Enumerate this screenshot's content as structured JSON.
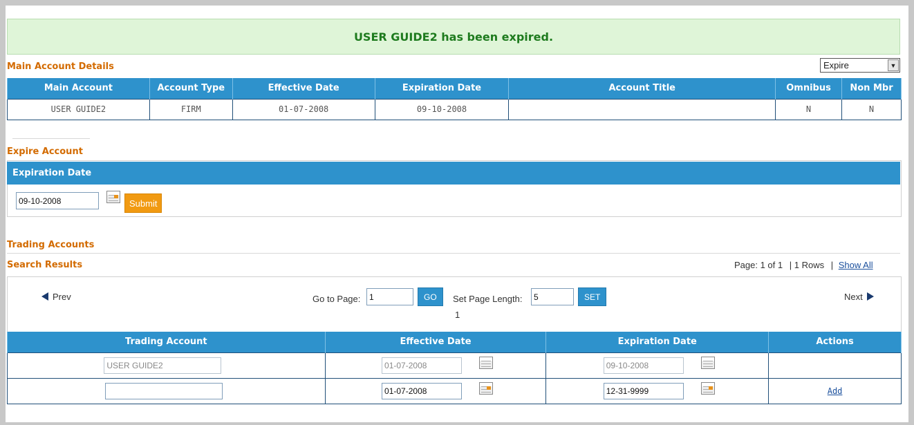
{
  "banner": {
    "message": "USER GUIDE2 has been expired."
  },
  "main_account": {
    "section_title": "Main Account Details",
    "action_select": {
      "value": "Expire"
    },
    "columns": [
      "Main Account",
      "Account Type",
      "Effective Date",
      "Expiration Date",
      "Account Title",
      "Omnibus",
      "Non Mbr"
    ],
    "row": {
      "main_account": "USER GUIDE2",
      "account_type": "FIRM",
      "effective_date": "01-07-2008",
      "expiration_date": "09-10-2008",
      "account_title": "",
      "omnibus": "N",
      "non_mbr": "N"
    }
  },
  "expire_account": {
    "section_title": "Expire Account",
    "header": "Expiration Date",
    "date_value": "09-10-2008",
    "submit_label": "Submit"
  },
  "trading_accounts": {
    "section_title": "Trading Accounts",
    "search_results_title": "Search Results",
    "page_info": "Page: 1 of 1",
    "rows_info": "| 1 Rows",
    "show_all_sep": "|",
    "show_all_label": "Show All",
    "prev_label": "Prev",
    "next_label": "Next",
    "goto_label": "Go to Page:",
    "goto_value": "1",
    "go_label": "GO",
    "page_length_label": "Set Page Length:",
    "page_length_value": "5",
    "set_label": "SET",
    "page_number": "1",
    "columns": [
      "Trading Account",
      "Effective Date",
      "Expiration Date",
      "Actions"
    ],
    "rows": [
      {
        "trading_account": "USER GUIDE2",
        "effective_date": "01-07-2008",
        "expiration_date": "09-10-2008",
        "action": ""
      },
      {
        "trading_account": "",
        "effective_date": "01-07-2008",
        "expiration_date": "12-31-9999",
        "action": "Add"
      }
    ]
  },
  "colors": {
    "header_blue": "#2e92cc",
    "section_orange": "#d36b00",
    "banner_green": "#1e7b1e",
    "button_orange": "#f19a12"
  },
  "icons": [
    "calendar-icon",
    "prev-arrow-icon",
    "next-arrow-icon",
    "dropdown-arrow-icon"
  ]
}
